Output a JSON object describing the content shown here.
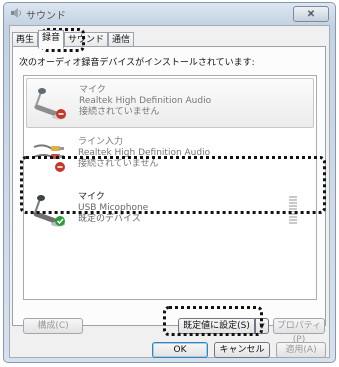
{
  "window": {
    "title": "サウンド"
  },
  "tabs": [
    {
      "label": "再生"
    },
    {
      "label": "録音"
    },
    {
      "label": "サウンド"
    },
    {
      "label": "通信"
    }
  ],
  "panel": {
    "intro": "次のオーディオ録音デバイスがインストールされています:"
  },
  "devices": [
    {
      "name": "マイク",
      "driver": "Realtek High Definition Audio",
      "status": "接続されていません"
    },
    {
      "name": "ライン入力",
      "driver": "Realtek High Definition Audio",
      "status": "接続されていません"
    },
    {
      "name": "マイク",
      "driver": "USB Micophone",
      "status": "既定のデバイス"
    }
  ],
  "buttons": {
    "configure": "構成(C)",
    "set_default": "既定値に設定(S)",
    "properties": "プロパティ(P)",
    "ok": "OK",
    "cancel": "キャンセル",
    "apply": "適用(A)"
  },
  "icons": {
    "app": "speaker-icon",
    "mic": "microphone-icon",
    "line_in": "line-in-plug-icon",
    "disconnected": "disconnected-badge-icon",
    "default": "default-check-badge-icon"
  },
  "colors": {
    "accent": "#3c7fb1",
    "default_badge": "#2e9a3a",
    "disconnected_badge": "#c0392b"
  }
}
